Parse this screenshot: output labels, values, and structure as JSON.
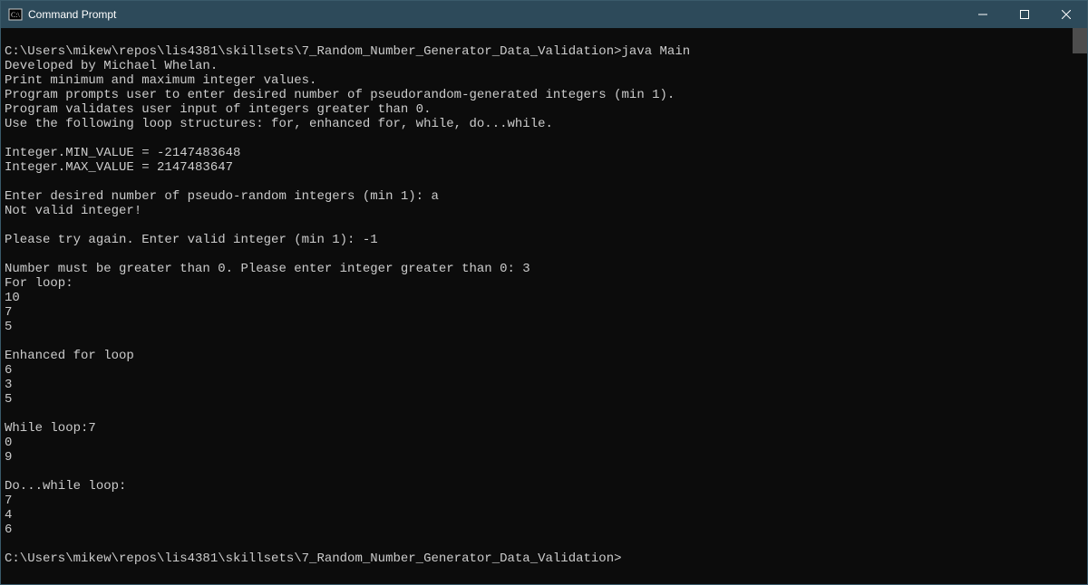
{
  "window": {
    "title": "Command Prompt"
  },
  "terminal": {
    "lines": [
      "",
      "C:\\Users\\mikew\\repos\\lis4381\\skillsets\\7_Random_Number_Generator_Data_Validation>java Main",
      "Developed by Michael Whelan.",
      "Print minimum and maximum integer values.",
      "Program prompts user to enter desired number of pseudorandom-generated integers (min 1).",
      "Program validates user input of integers greater than 0.",
      "Use the following loop structures: for, enhanced for, while, do...while.",
      "",
      "Integer.MIN_VALUE = -2147483648",
      "Integer.MAX_VALUE = 2147483647",
      "",
      "Enter desired number of pseudo-random integers (min 1): a",
      "Not valid integer!",
      "",
      "Please try again. Enter valid integer (min 1): -1",
      "",
      "Number must be greater than 0. Please enter integer greater than 0: 3",
      "For loop:",
      "10",
      "7",
      "5",
      "",
      "Enhanced for loop",
      "6",
      "3",
      "5",
      "",
      "While loop:7",
      "0",
      "9",
      "",
      "Do...while loop:",
      "7",
      "4",
      "6",
      "",
      "C:\\Users\\mikew\\repos\\lis4381\\skillsets\\7_Random_Number_Generator_Data_Validation>"
    ]
  }
}
